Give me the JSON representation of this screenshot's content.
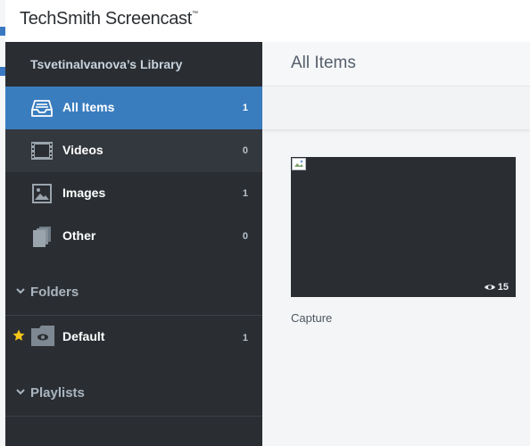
{
  "app": {
    "logo_text": "TechSmith Screencast",
    "logo_mark": "™"
  },
  "sidebar": {
    "library_title": "Tsvetinalvanova’s Library",
    "items": [
      {
        "label": "All Items",
        "count": "1",
        "icon": "inbox-tray-icon",
        "active": true
      },
      {
        "label": "Videos",
        "count": "0",
        "icon": "film-strip-icon"
      },
      {
        "label": "Images",
        "count": "1",
        "icon": "image-icon"
      },
      {
        "label": "Other",
        "count": "0",
        "icon": "stacked-files-icon"
      }
    ],
    "folders_heading": "Folders",
    "folders": [
      {
        "label": "Default",
        "count": "1",
        "starred": true
      }
    ],
    "playlists_heading": "Playlists"
  },
  "main": {
    "title": "All Items",
    "items": [
      {
        "caption": "Capture",
        "views": "15"
      }
    ]
  },
  "colors": {
    "sidebar_bg": "#2a2e33",
    "accent_blue": "#3a7dbf",
    "star_yellow": "#f5c518",
    "main_bg": "#f4f5f7"
  }
}
